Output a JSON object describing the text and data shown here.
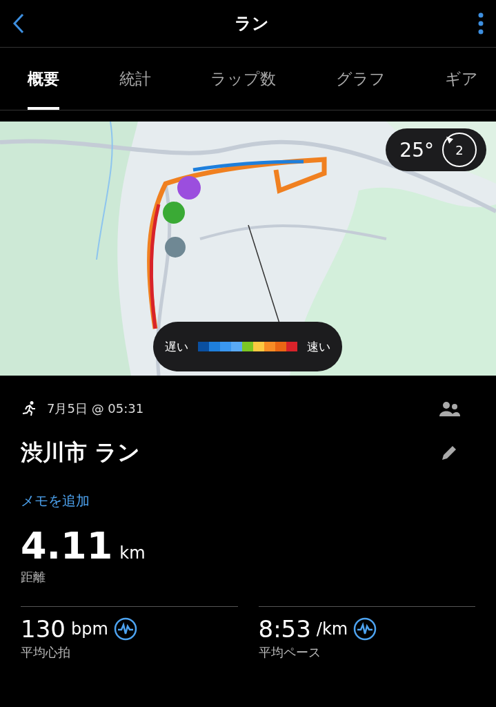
{
  "header": {
    "title": "ラン"
  },
  "tabs": [
    {
      "label": "概要",
      "selected": true
    },
    {
      "label": "統計",
      "selected": false
    },
    {
      "label": "ラップ数",
      "selected": false
    },
    {
      "label": "グラフ",
      "selected": false
    },
    {
      "label": "ギア",
      "selected": false
    }
  ],
  "map": {
    "kind": "picture",
    "weather": {
      "temperature": "25°",
      "wind": "2"
    },
    "legend": {
      "slow_label": "遅い",
      "fast_label": "速い",
      "segments": [
        {
          "color": "#0a4fa0"
        },
        {
          "color": "#1e7fdc"
        },
        {
          "color": "#3a97f0"
        },
        {
          "color": "#5aaaf5"
        },
        {
          "color": "#7cc623"
        },
        {
          "color": "#fbc841"
        },
        {
          "color": "#f78c25"
        },
        {
          "color": "#ea6614"
        },
        {
          "color": "#d8232a"
        }
      ]
    }
  },
  "activity": {
    "date": "7月5日 @ 05:31",
    "name": "渋川市 ラン",
    "add_note": "メモを追加",
    "distance": {
      "value": "4.11",
      "unit": "km",
      "label": "距離"
    },
    "stats": [
      {
        "value": "130",
        "unit": "bpm",
        "label": "平均心拍"
      },
      {
        "value": "8:53",
        "unit": "/km",
        "label": "平均ペース"
      }
    ]
  }
}
